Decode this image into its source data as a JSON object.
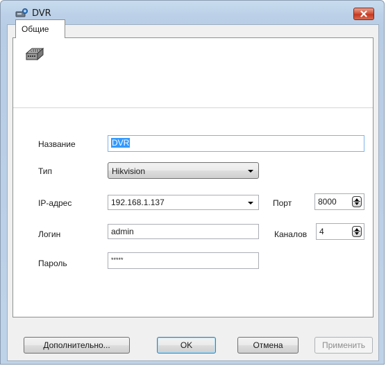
{
  "window": {
    "title": "DVR",
    "title_icon": "dvr-settings-icon",
    "close_icon": "close-icon"
  },
  "tabs": [
    {
      "label": "Общие",
      "selected": true
    }
  ],
  "device_icon": "dvr-device-icon",
  "form": {
    "name_label": "Название",
    "name_value": "DVR",
    "type_label": "Тип",
    "type_value": "Hikvision",
    "ip_label": "IP-адрес",
    "ip_value": "192.168.1.137",
    "port_label": "Порт",
    "port_value": "8000",
    "login_label": "Логин",
    "login_value": "admin",
    "channels_label": "Каналов",
    "channels_value": "4",
    "password_label": "Пароль",
    "password_value": "*****"
  },
  "buttons": {
    "advanced": "Дополнительно...",
    "ok": "OK",
    "cancel": "Отмена",
    "apply": "Применить"
  },
  "colors": {
    "title_gradient": "#bcd1e8",
    "close_button": "#d4553d",
    "selection": "#3399ff",
    "focus_border": "#7eb4ea"
  }
}
